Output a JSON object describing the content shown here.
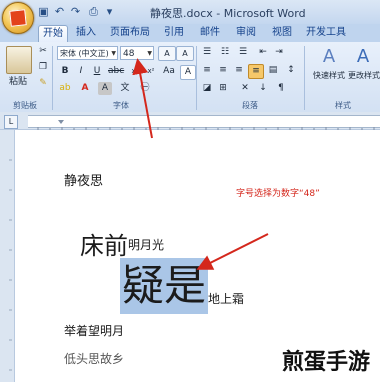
{
  "title_bar": {
    "title": "静夜思.docx - Microsoft Word"
  },
  "quick_access": [
    "save-icon",
    "undo-icon",
    "redo-icon",
    "print-icon",
    "dropdown-icon"
  ],
  "tabs": [
    "开始",
    "插入",
    "页面布局",
    "引用",
    "邮件",
    "审阅",
    "视图",
    "开发工具"
  ],
  "ribbon": {
    "clipboard": {
      "paste_label": "粘贴",
      "group_label": "剪贴板"
    },
    "font": {
      "font_name": "宋体 (中文正)",
      "font_size": "48",
      "group_label": "字体"
    },
    "paragraph": {
      "group_label": "段落"
    },
    "styles": {
      "quick_styles_label": "快速样式",
      "change_styles_label": "更改样式",
      "group_label": "样式"
    }
  },
  "document": {
    "title_line": "静夜思",
    "line2_big": "床前",
    "line2_small": "明月光",
    "line3_selected": "疑是",
    "line3_small": "地上霜",
    "line4": "举着望明月",
    "line5": "低头思故乡"
  },
  "annotation": {
    "text": "字号选择为数字“48”",
    "color": "#d4271c"
  },
  "watermark": {
    "text": "煎蛋手游"
  }
}
